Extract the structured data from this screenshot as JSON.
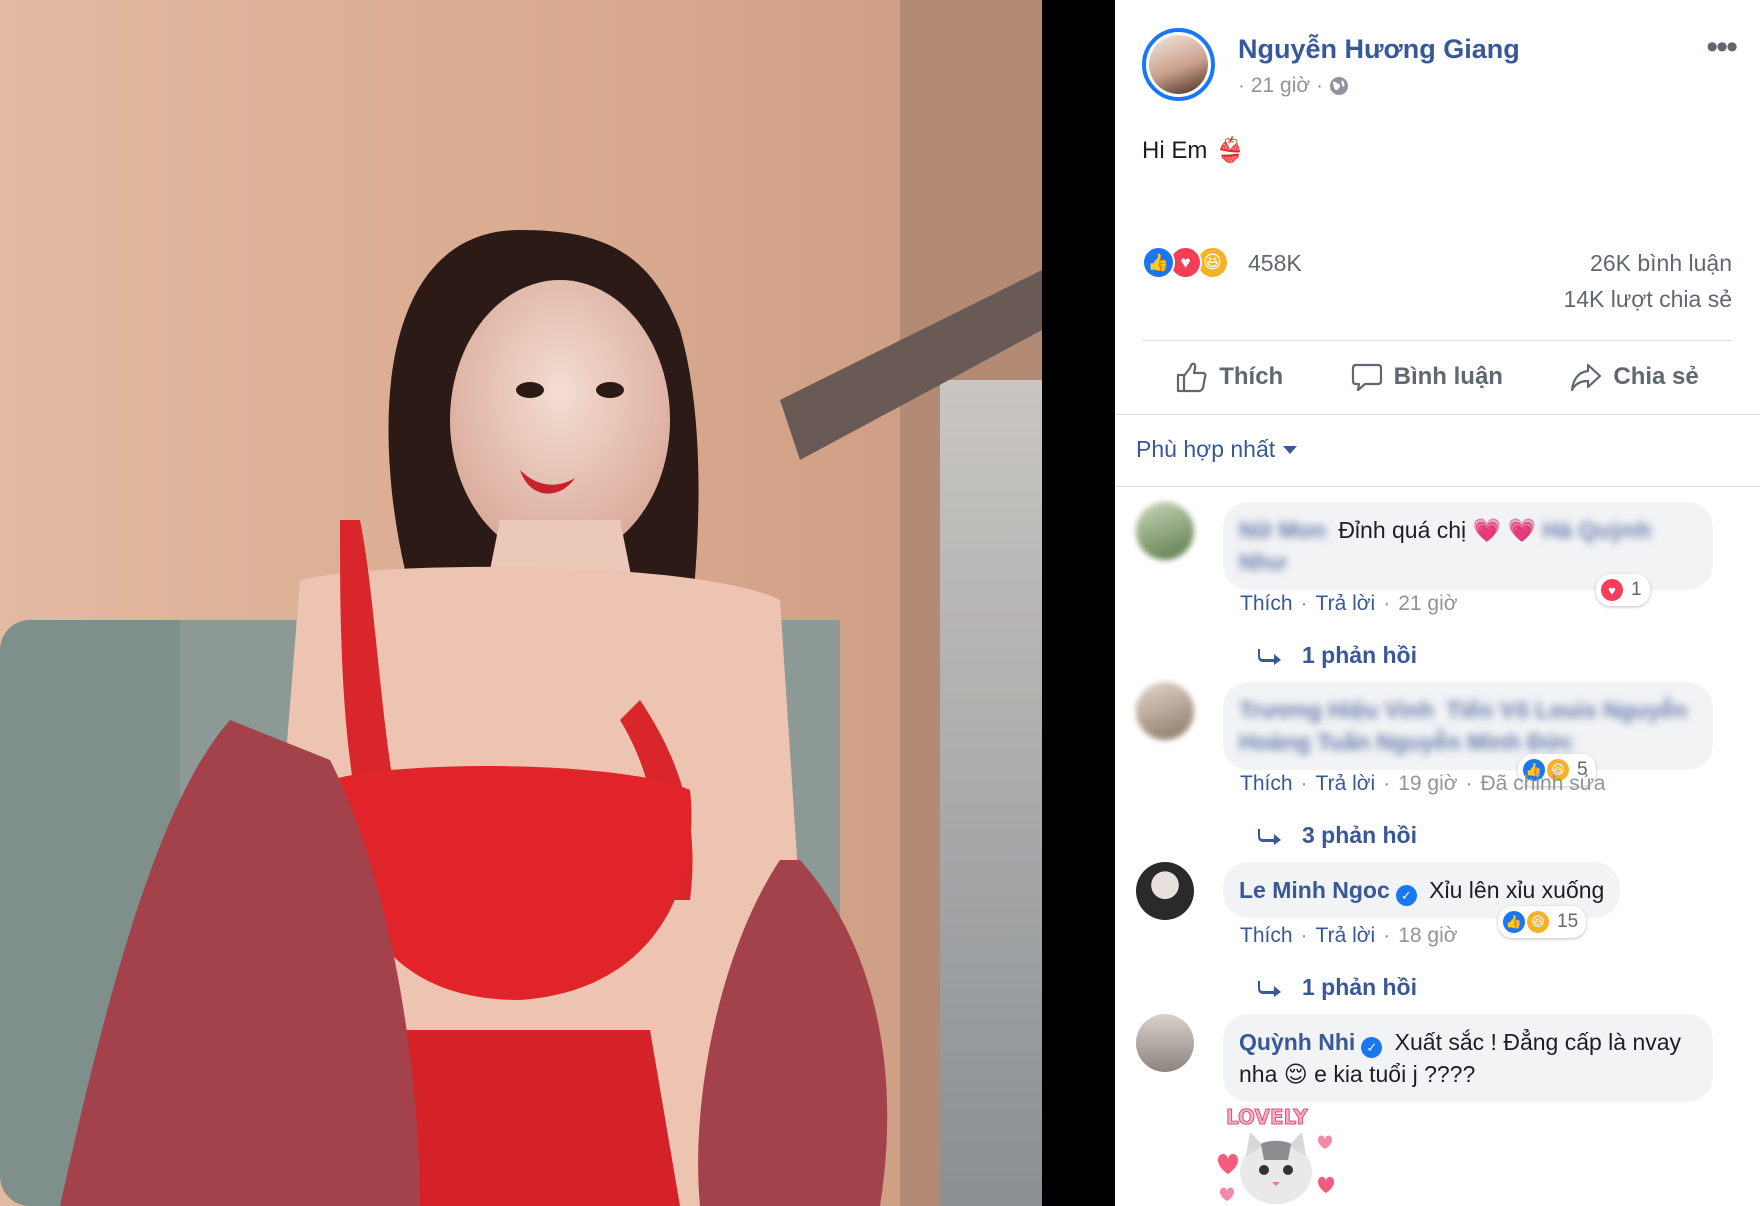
{
  "post": {
    "author": "Nguyễn Hương Giang",
    "time": "· 21 giờ ·",
    "caption": "Hi Em",
    "caption_emoji": "👙",
    "reactions_count": "458K",
    "comments_count": "26K bình luận",
    "shares_count": "14K lượt chia sẻ"
  },
  "actions": {
    "like": "Thích",
    "comment": "Bình luận",
    "share": "Chia sẻ"
  },
  "sort": {
    "label": "Phù hợp nhất"
  },
  "comments": [
    {
      "name": "Nữ Mon",
      "text": "Đỉnh quá chị",
      "emojis": "💗 💗",
      "tag": "Hà Quỳnh Như",
      "like": "Thích",
      "reply": "Trả lời",
      "time": "21 giờ",
      "reaction_count": "1",
      "replies": "1 phản hồi"
    },
    {
      "name": "Trương Hiệu Vinh",
      "text": "Tiến Võ Louis Nguyễn Hoàng Tuấn Nguyễn Minh Đức",
      "like": "Thích",
      "reply": "Trả lời",
      "time": "19 giờ",
      "edited": "Đã chỉnh sửa",
      "reaction_count": "5",
      "replies": "3 phản hồi"
    },
    {
      "name": "Le Minh Ngoc",
      "text": "Xỉu lên xỉu xuống",
      "like": "Thích",
      "reply": "Trả lời",
      "time": "18 giờ",
      "reaction_count": "15",
      "replies": "1 phản hồi"
    },
    {
      "name": "Quỳnh Nhi",
      "text": "Xuất sắc ! Đẳng cấp là nvay",
      "text2a": "nha",
      "emoji": "😌",
      "text2b": "e kia tuổi j ????",
      "sticker_label": "LOVELY"
    }
  ],
  "colors": {
    "fb_blue": "#385898",
    "like_blue": "#1877f2",
    "love_red": "#f33e58",
    "haha_yellow": "#f7b125"
  }
}
